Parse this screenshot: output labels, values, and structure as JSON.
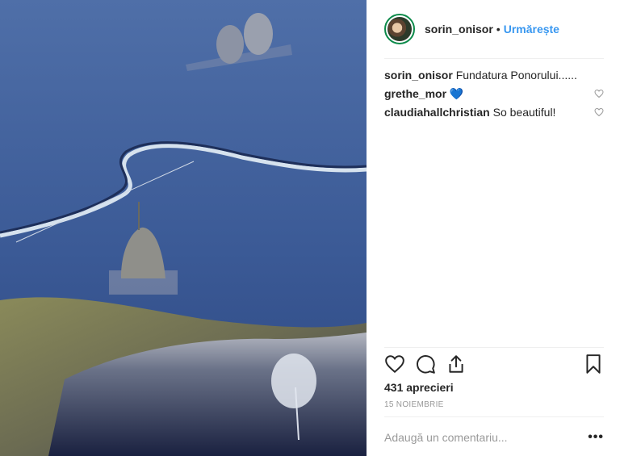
{
  "post": {
    "username": "sorin_onisor",
    "separator": "•",
    "follow_label": "Urmărește",
    "caption_user": "sorin_onisor",
    "caption_text": "Fundatura Ponorului......",
    "likes": "431 aprecieri",
    "date": "15 NOIEMBRIE",
    "comment_placeholder": "Adaugă un comentariu...",
    "more_label": "•••"
  },
  "comments": [
    {
      "user": "grethe_mor",
      "text": "💙"
    },
    {
      "user": "claudiahallchristian",
      "text": "So beautiful!"
    }
  ],
  "icons": {
    "like": "heart-icon",
    "comment": "comment-bubble-icon",
    "share": "share-icon",
    "save": "bookmark-icon"
  },
  "colors": {
    "accent": "#3897f0",
    "text": "#262626",
    "muted": "#999999"
  }
}
